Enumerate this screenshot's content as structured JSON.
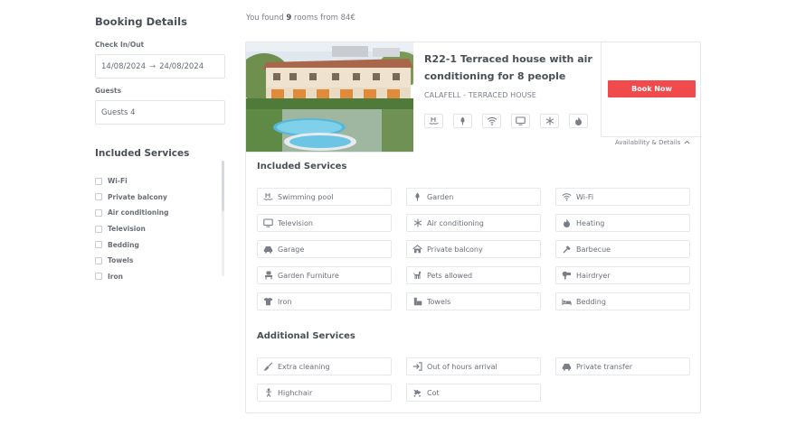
{
  "sidebar": {
    "title": "Booking Details",
    "check_label": "Check In/Out",
    "check_in": "14/08/2024",
    "check_arrow": "→",
    "check_out": "24/08/2024",
    "guests_label": "Guests",
    "guests_value": "Guests 4",
    "services_title": "Included Services",
    "services": [
      "Wi-Fi",
      "Private balcony",
      "Air conditioning",
      "Television",
      "Bedding",
      "Towels",
      "Iron"
    ]
  },
  "results": {
    "prefix": "You found ",
    "count": "9",
    "suffix": " rooms from 84€"
  },
  "room": {
    "title": "R22-1 Terraced house with air conditioning for 8 people",
    "subtitle": "CALAFELL - TERRACED HOUSE",
    "amenity_icons": [
      "pool-icon",
      "garden-icon",
      "wifi-icon",
      "tv-icon",
      "snowflake-icon",
      "flame-icon"
    ],
    "book_label": "Book Now",
    "availability_label": "Availability & Details",
    "included_title": "Included Services",
    "included": [
      {
        "label": "Swimming pool",
        "icon": "pool-icon"
      },
      {
        "label": "Garden",
        "icon": "garden-icon"
      },
      {
        "label": "Wi-Fi",
        "icon": "wifi-icon"
      },
      {
        "label": "Television",
        "icon": "tv-icon"
      },
      {
        "label": "Air conditioning",
        "icon": "snowflake-icon"
      },
      {
        "label": "Heating",
        "icon": "flame-icon"
      },
      {
        "label": "Garage",
        "icon": "car-icon"
      },
      {
        "label": "Private balcony",
        "icon": "home-icon"
      },
      {
        "label": "Barbecue",
        "icon": "barbecue-icon"
      },
      {
        "label": "Garden Furniture",
        "icon": "chair-icon"
      },
      {
        "label": "Pets allowed",
        "icon": "dog-icon"
      },
      {
        "label": "Hairdryer",
        "icon": "hairdryer-icon"
      },
      {
        "label": "Iron",
        "icon": "shirt-icon"
      },
      {
        "label": "Towels",
        "icon": "towel-icon"
      },
      {
        "label": "Bedding",
        "icon": "bed-icon"
      }
    ],
    "additional_title": "Additional Services",
    "additional": [
      {
        "label": "Extra cleaning",
        "icon": "broom-icon"
      },
      {
        "label": "Out of hours arrival",
        "icon": "sign-in-icon"
      },
      {
        "label": "Private transfer",
        "icon": "car-icon"
      },
      {
        "label": "Highchair",
        "icon": "baby-icon"
      },
      {
        "label": "Cot",
        "icon": "cot-icon"
      }
    ]
  },
  "colors": {
    "accent": "#f04a4c",
    "text": "#4a4f57",
    "muted": "#7a7f87",
    "border": "#e6e8eb"
  }
}
